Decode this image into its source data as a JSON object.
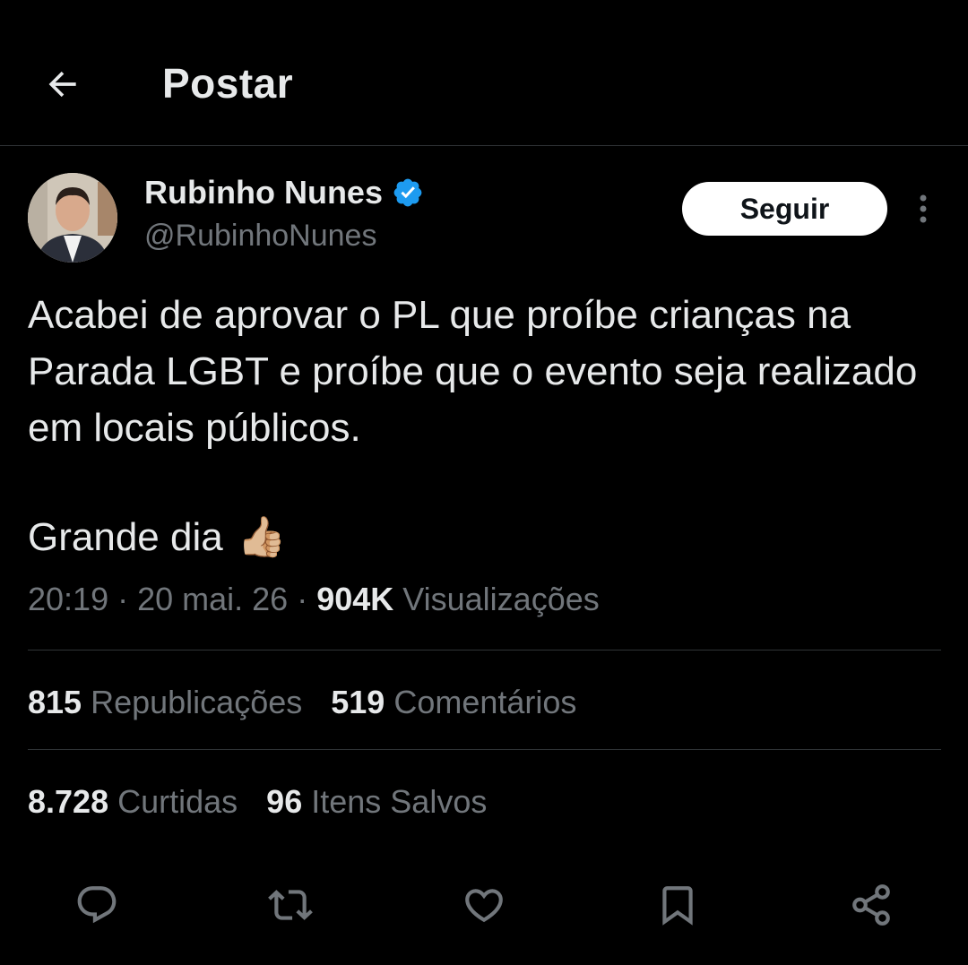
{
  "header": {
    "title": "Postar",
    "back_icon": "arrow-left-icon"
  },
  "author": {
    "name": "Rubinho Nunes",
    "handle": "@RubinhoNunes",
    "verified_icon": "verified-badge-icon",
    "verified_color": "#1d9bf0"
  },
  "follow_button": {
    "label": "Seguir"
  },
  "more_icon": "more-vertical-icon",
  "post": {
    "text": "Acabei de aprovar o PL que proíbe crianças na Parada LGBT e proíbe que o evento seja realizado em locais públicos.",
    "line2_text": "Grande dia",
    "line2_emoji": "👍🏼"
  },
  "meta": {
    "time": "20:19",
    "date": "20 mai. 26",
    "views_count": "904K",
    "views_label": "Visualizações",
    "separator": " · "
  },
  "stats": {
    "reposts_count": "815",
    "reposts_label": "Republicações",
    "comments_count": "519",
    "comments_label": "Comentários",
    "likes_count": "8.728",
    "likes_label": "Curtidas",
    "saves_count": "96",
    "saves_label": "Itens Salvos"
  },
  "actions": [
    {
      "icon": "reply-icon"
    },
    {
      "icon": "repost-icon"
    },
    {
      "icon": "like-icon"
    },
    {
      "icon": "bookmark-icon"
    },
    {
      "icon": "share-icon"
    }
  ],
  "colors": {
    "background": "#000000",
    "text_primary": "#e7e9ea",
    "text_secondary": "#71767b",
    "divider": "#2f3336",
    "follow_bg": "#ffffff"
  }
}
